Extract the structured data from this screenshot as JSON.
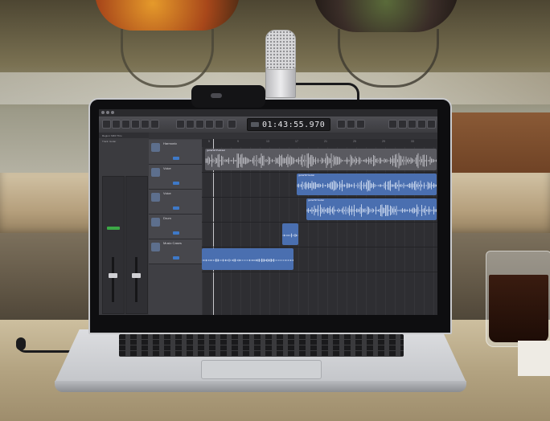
{
  "scene": {
    "description_colors": {
      "accent_region_blue": "#4a6fb0",
      "region_header_blue": "#5b82c9",
      "record_green": "#3ca846"
    }
  },
  "daw": {
    "window_title": "",
    "lcd_time": "01:43:55.970",
    "inspector": {
      "region_header": "Region: MIDI Thru",
      "track_header": "Track: Guitar",
      "strip_left_name": "",
      "strip_right_name": ""
    },
    "tracks": [
      {
        "name": "Harmonic"
      },
      {
        "name": "Voice"
      },
      {
        "name": "Voice"
      },
      {
        "name": "Drum"
      },
      {
        "name": "Music Cases"
      }
    ],
    "ruler_numbers": [
      "5",
      "9",
      "13",
      "17",
      "21",
      "25",
      "29",
      "33"
    ],
    "regions": [
      {
        "name": "guitarSP.Podcast"
      },
      {
        "name": "guitarSP.Guitar"
      },
      {
        "name": "guitarSP.Guitar"
      },
      {
        "name": ""
      },
      {
        "name": ""
      }
    ]
  }
}
